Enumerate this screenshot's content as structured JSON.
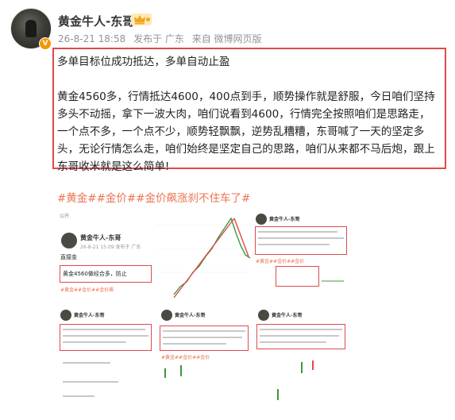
{
  "user": {
    "name": "黄金牛人-东哥",
    "verified_badge": "V"
  },
  "meta": {
    "time": "26-8-21 18:58",
    "location": "发布于 广东",
    "source": "来自 微博网页版"
  },
  "post": {
    "line1": "多单目标位成功抵达，多单自动止盈",
    "body": "黄金4560多，行情抵达4600，400点到手，顺势操作就是舒服，今日咱们坚持多头不动摇，拿下一波大肉，咱们说看到4600，行情完全按照咱们是思路走，一个点不多，一个点不少，顺势轻飘飘，逆势乱糟糟，东哥喊了一天的坚定多头，无论行情怎么走，咱们始终是坚定自己的思路，咱们从来都不马后炮，跟上东哥收米就是这么简单!"
  },
  "hashtags": "#黄金##金价##金价飙涨刹不住车了#",
  "thumbs": {
    "t1": {
      "label_public": "公开",
      "name": "黄金牛人-东哥",
      "time": "26-8-21 15:09 发布于 广东",
      "text1": "直接金",
      "text2": "黄金4560做经合多，防止",
      "tags": "#黄金##金价##金价飙"
    },
    "t3": {
      "name": "黄金牛人-东哥",
      "tags": "#黄金##金价##金价"
    },
    "t4": {
      "name": "黄金牛人-东哥"
    },
    "t5": {
      "name": "黄金牛人-东哥",
      "tags": "#黄金##金价##金价"
    },
    "t6": {
      "name": "黄金牛人-东哥"
    }
  },
  "colors": {
    "accent": "#eb7350",
    "box": "#e04a4a",
    "meta": "#939393",
    "vip": "#f39800"
  },
  "icons": {
    "crown": "crown-vip-icon",
    "verified": "verified-badge-icon"
  }
}
